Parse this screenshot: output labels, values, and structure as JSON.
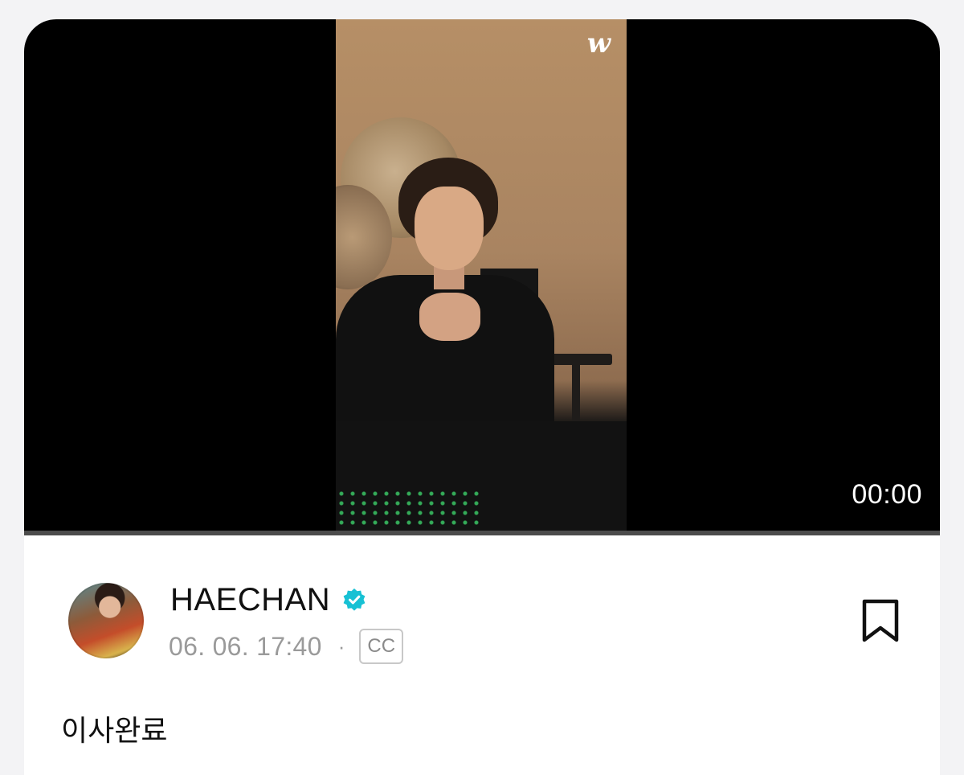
{
  "player": {
    "watermark": "w",
    "time": "00:00",
    "progress": 0
  },
  "post": {
    "artist_name": "HAECHAN",
    "verified": true,
    "date": "06. 06. 17:40",
    "separator": "·",
    "cc_label": "CC",
    "caption": "이사완료"
  },
  "icons": {
    "verified": "verified-badge-icon",
    "bookmark": "bookmark-icon"
  },
  "colors": {
    "verified_badge": "#17c1d4",
    "player_background": "#000000",
    "meta_text": "#9a9a9a"
  }
}
